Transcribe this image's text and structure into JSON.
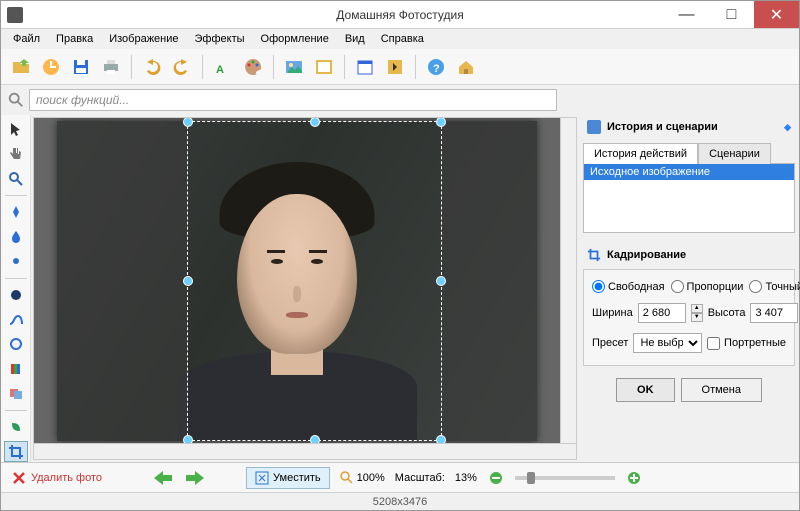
{
  "window": {
    "title": "Домашняя Фотостудия"
  },
  "menu": [
    "Файл",
    "Правка",
    "Изображение",
    "Эффекты",
    "Оформление",
    "Вид",
    "Справка"
  ],
  "search": {
    "placeholder": "поиск функций..."
  },
  "right": {
    "panel_title": "История и сценарии",
    "tabs": {
      "history": "История действий",
      "scenarios": "Сценарии"
    },
    "history_items": [
      "Исходное изображение"
    ],
    "crop_title": "Кадрирование",
    "radio": {
      "free": "Свободная",
      "ratio": "Пропорции",
      "exact": "Точный размер"
    },
    "labels": {
      "width": "Ширина",
      "height": "Высота",
      "preset": "Пресет",
      "portrait": "Портретные"
    },
    "values": {
      "width": "2 680",
      "height": "3 407",
      "preset": "Не выбрано"
    },
    "buttons": {
      "ok": "OK",
      "cancel": "Отмена"
    }
  },
  "bottom": {
    "delete": "Удалить фото",
    "fit": "Уместить",
    "zoom_100": "100%",
    "scale_label": "Масштаб:",
    "scale_value": "13%"
  },
  "status": {
    "dimensions": "5208x3476"
  }
}
